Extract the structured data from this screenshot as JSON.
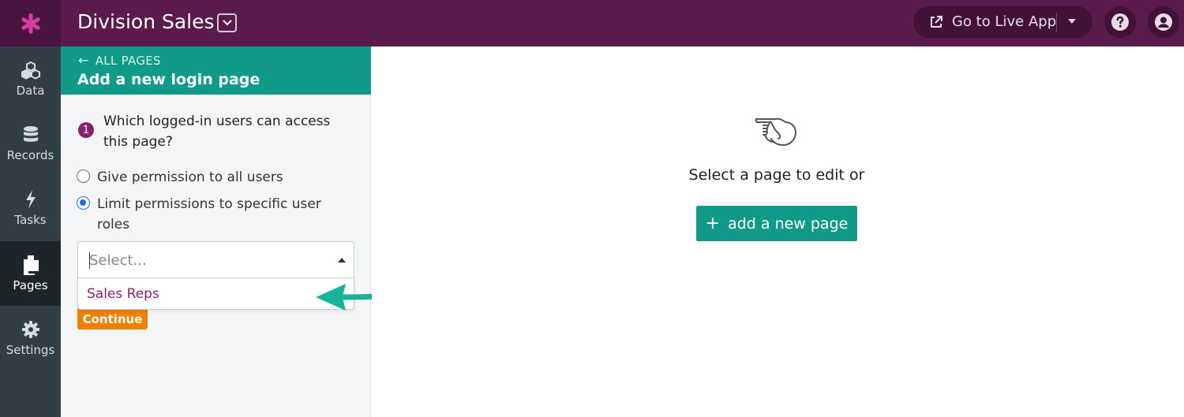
{
  "topbar": {
    "app_title": "Division Sales",
    "live_app_label": "Go to Live App",
    "brand_color": "#5a1a4c"
  },
  "nav": {
    "items": [
      {
        "label": "Data",
        "icon": "cubes-icon"
      },
      {
        "label": "Records",
        "icon": "database-icon"
      },
      {
        "label": "Tasks",
        "icon": "bolt-icon"
      },
      {
        "label": "Pages",
        "icon": "pages-icon",
        "active": true
      },
      {
        "label": "Settings",
        "icon": "gear-icon"
      }
    ]
  },
  "panel": {
    "back_label": "ALL PAGES",
    "title": "Add a new login page",
    "header_color": "#11998a",
    "step_number": "1",
    "question": "Which logged-in users can access this page?",
    "options": [
      {
        "label": "Give permission to all users",
        "checked": false
      },
      {
        "label": "Limit permissions to specific user roles",
        "checked": true
      }
    ],
    "select_placeholder": "Select...",
    "dropdown_options": [
      "Sales Reps"
    ],
    "continue_label": "Continue"
  },
  "main": {
    "empty_text": "Select a page to edit or",
    "add_page_label": "add a new page"
  }
}
